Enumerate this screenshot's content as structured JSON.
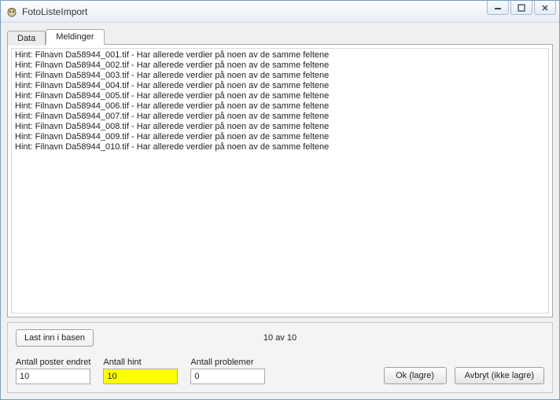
{
  "window": {
    "title": "FotoListeImport"
  },
  "tabs": {
    "data_label": "Data",
    "messages_label": "Meldinger"
  },
  "messages": [
    "Hint: Filnavn Da58944_001.tif - Har allerede verdier på noen av de samme feltene",
    "Hint: Filnavn Da58944_002.tif - Har allerede verdier på noen av de samme feltene",
    "Hint: Filnavn Da58944_003.tif - Har allerede verdier på noen av de samme feltene",
    "Hint: Filnavn Da58944_004.tif - Har allerede verdier på noen av de samme feltene",
    "Hint: Filnavn Da58944_005.tif - Har allerede verdier på noen av de samme feltene",
    "Hint: Filnavn Da58944_006.tif - Har allerede verdier på noen av de samme feltene",
    "Hint: Filnavn Da58944_007.tif - Har allerede verdier på noen av de samme feltene",
    "Hint: Filnavn Da58944_008.tif - Har allerede verdier på noen av de samme feltene",
    "Hint: Filnavn Da58944_009.tif - Har allerede verdier på noen av de samme feltene",
    "Hint: Filnavn Da58944_010.tif - Har allerede verdier på noen av de samme feltene"
  ],
  "footer": {
    "load_button": "Last inn i basen",
    "count_status": "10 av 10",
    "records_changed_label": "Antall poster endret",
    "records_changed_value": "10",
    "hints_label": "Antall hint",
    "hints_value": "10",
    "problems_label": "Antall problemer",
    "problems_value": "0",
    "ok_button": "Ok (lagre)",
    "cancel_button": "Avbryt (ikke lagre)"
  }
}
